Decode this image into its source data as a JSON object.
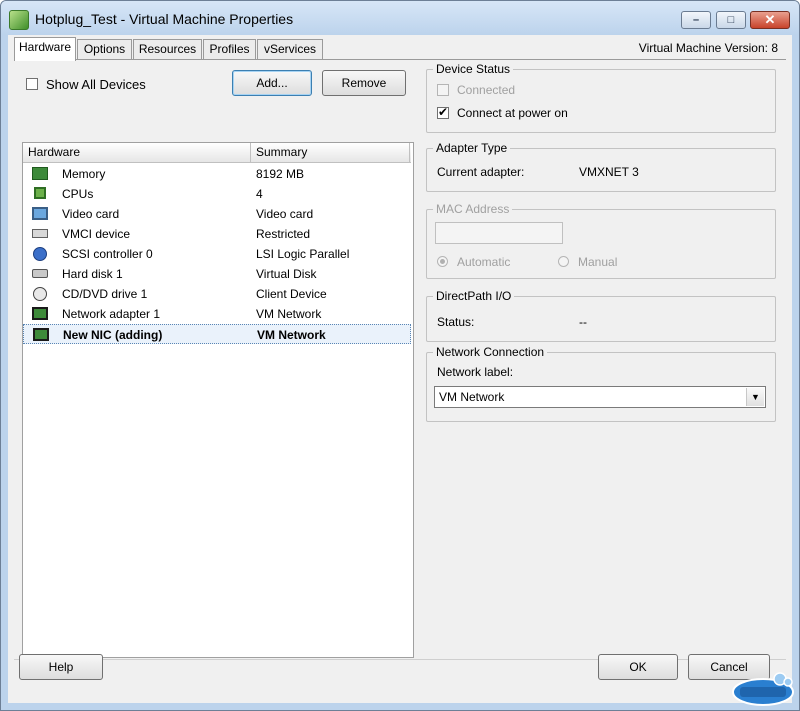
{
  "window": {
    "title": "Hotplug_Test - Virtual Machine Properties",
    "controls": {
      "minimize": "–",
      "maximize": "□",
      "close": "✕"
    }
  },
  "tabs": [
    {
      "label": "Hardware",
      "active": true
    },
    {
      "label": "Options"
    },
    {
      "label": "Resources"
    },
    {
      "label": "Profiles"
    },
    {
      "label": "vServices"
    }
  ],
  "vm_version": "Virtual Machine Version: 8",
  "hardware_panel": {
    "show_all_devices_label": "Show All Devices",
    "show_all_devices_checked": false,
    "add_button": "Add...",
    "remove_button": "Remove",
    "columns": {
      "hardware": "Hardware",
      "summary": "Summary"
    },
    "devices": [
      {
        "name": "Memory",
        "summary": "8192 MB",
        "icon": "memory-icon"
      },
      {
        "name": "CPUs",
        "summary": "4",
        "icon": "cpu-icon"
      },
      {
        "name": "Video card",
        "summary": "Video card",
        "icon": "monitor-icon"
      },
      {
        "name": "VMCI device",
        "summary": "Restricted",
        "icon": "vmci-icon"
      },
      {
        "name": "SCSI controller 0",
        "summary": "LSI Logic Parallel",
        "icon": "scsi-controller-icon"
      },
      {
        "name": "Hard disk 1",
        "summary": "Virtual Disk",
        "icon": "hard-disk-icon"
      },
      {
        "name": "CD/DVD drive 1",
        "summary": "Client Device",
        "icon": "cd-dvd-icon"
      },
      {
        "name": "Network adapter 1",
        "summary": "VM Network",
        "icon": "network-adapter-icon"
      },
      {
        "name": "New NIC (adding)",
        "summary": "VM Network",
        "icon": "network-adapter-icon",
        "selected": true
      }
    ]
  },
  "device_status": {
    "title": "Device Status",
    "connected_label": "Connected",
    "connected_checked": false,
    "connect_at_power_on_label": "Connect at power on",
    "connect_at_power_on_checked": true
  },
  "adapter_type": {
    "title": "Adapter Type",
    "current_adapter_label": "Current adapter:",
    "current_adapter_value": "VMXNET 3"
  },
  "mac_address": {
    "title": "MAC Address",
    "value": "",
    "automatic_label": "Automatic",
    "manual_label": "Manual",
    "selected": "Automatic"
  },
  "directpath": {
    "title": "DirectPath I/O",
    "status_label": "Status:",
    "status_value": "--"
  },
  "network_connection": {
    "title": "Network Connection",
    "network_label": "Network label:",
    "selected_network": "VM Network"
  },
  "footer": {
    "help_button": "Help",
    "ok_button": "OK",
    "cancel_button": "Cancel"
  },
  "colors": {
    "title_bar": "#bcd3ec",
    "close_button": "#c8432b",
    "selected_row_border": "#5a86b5"
  }
}
